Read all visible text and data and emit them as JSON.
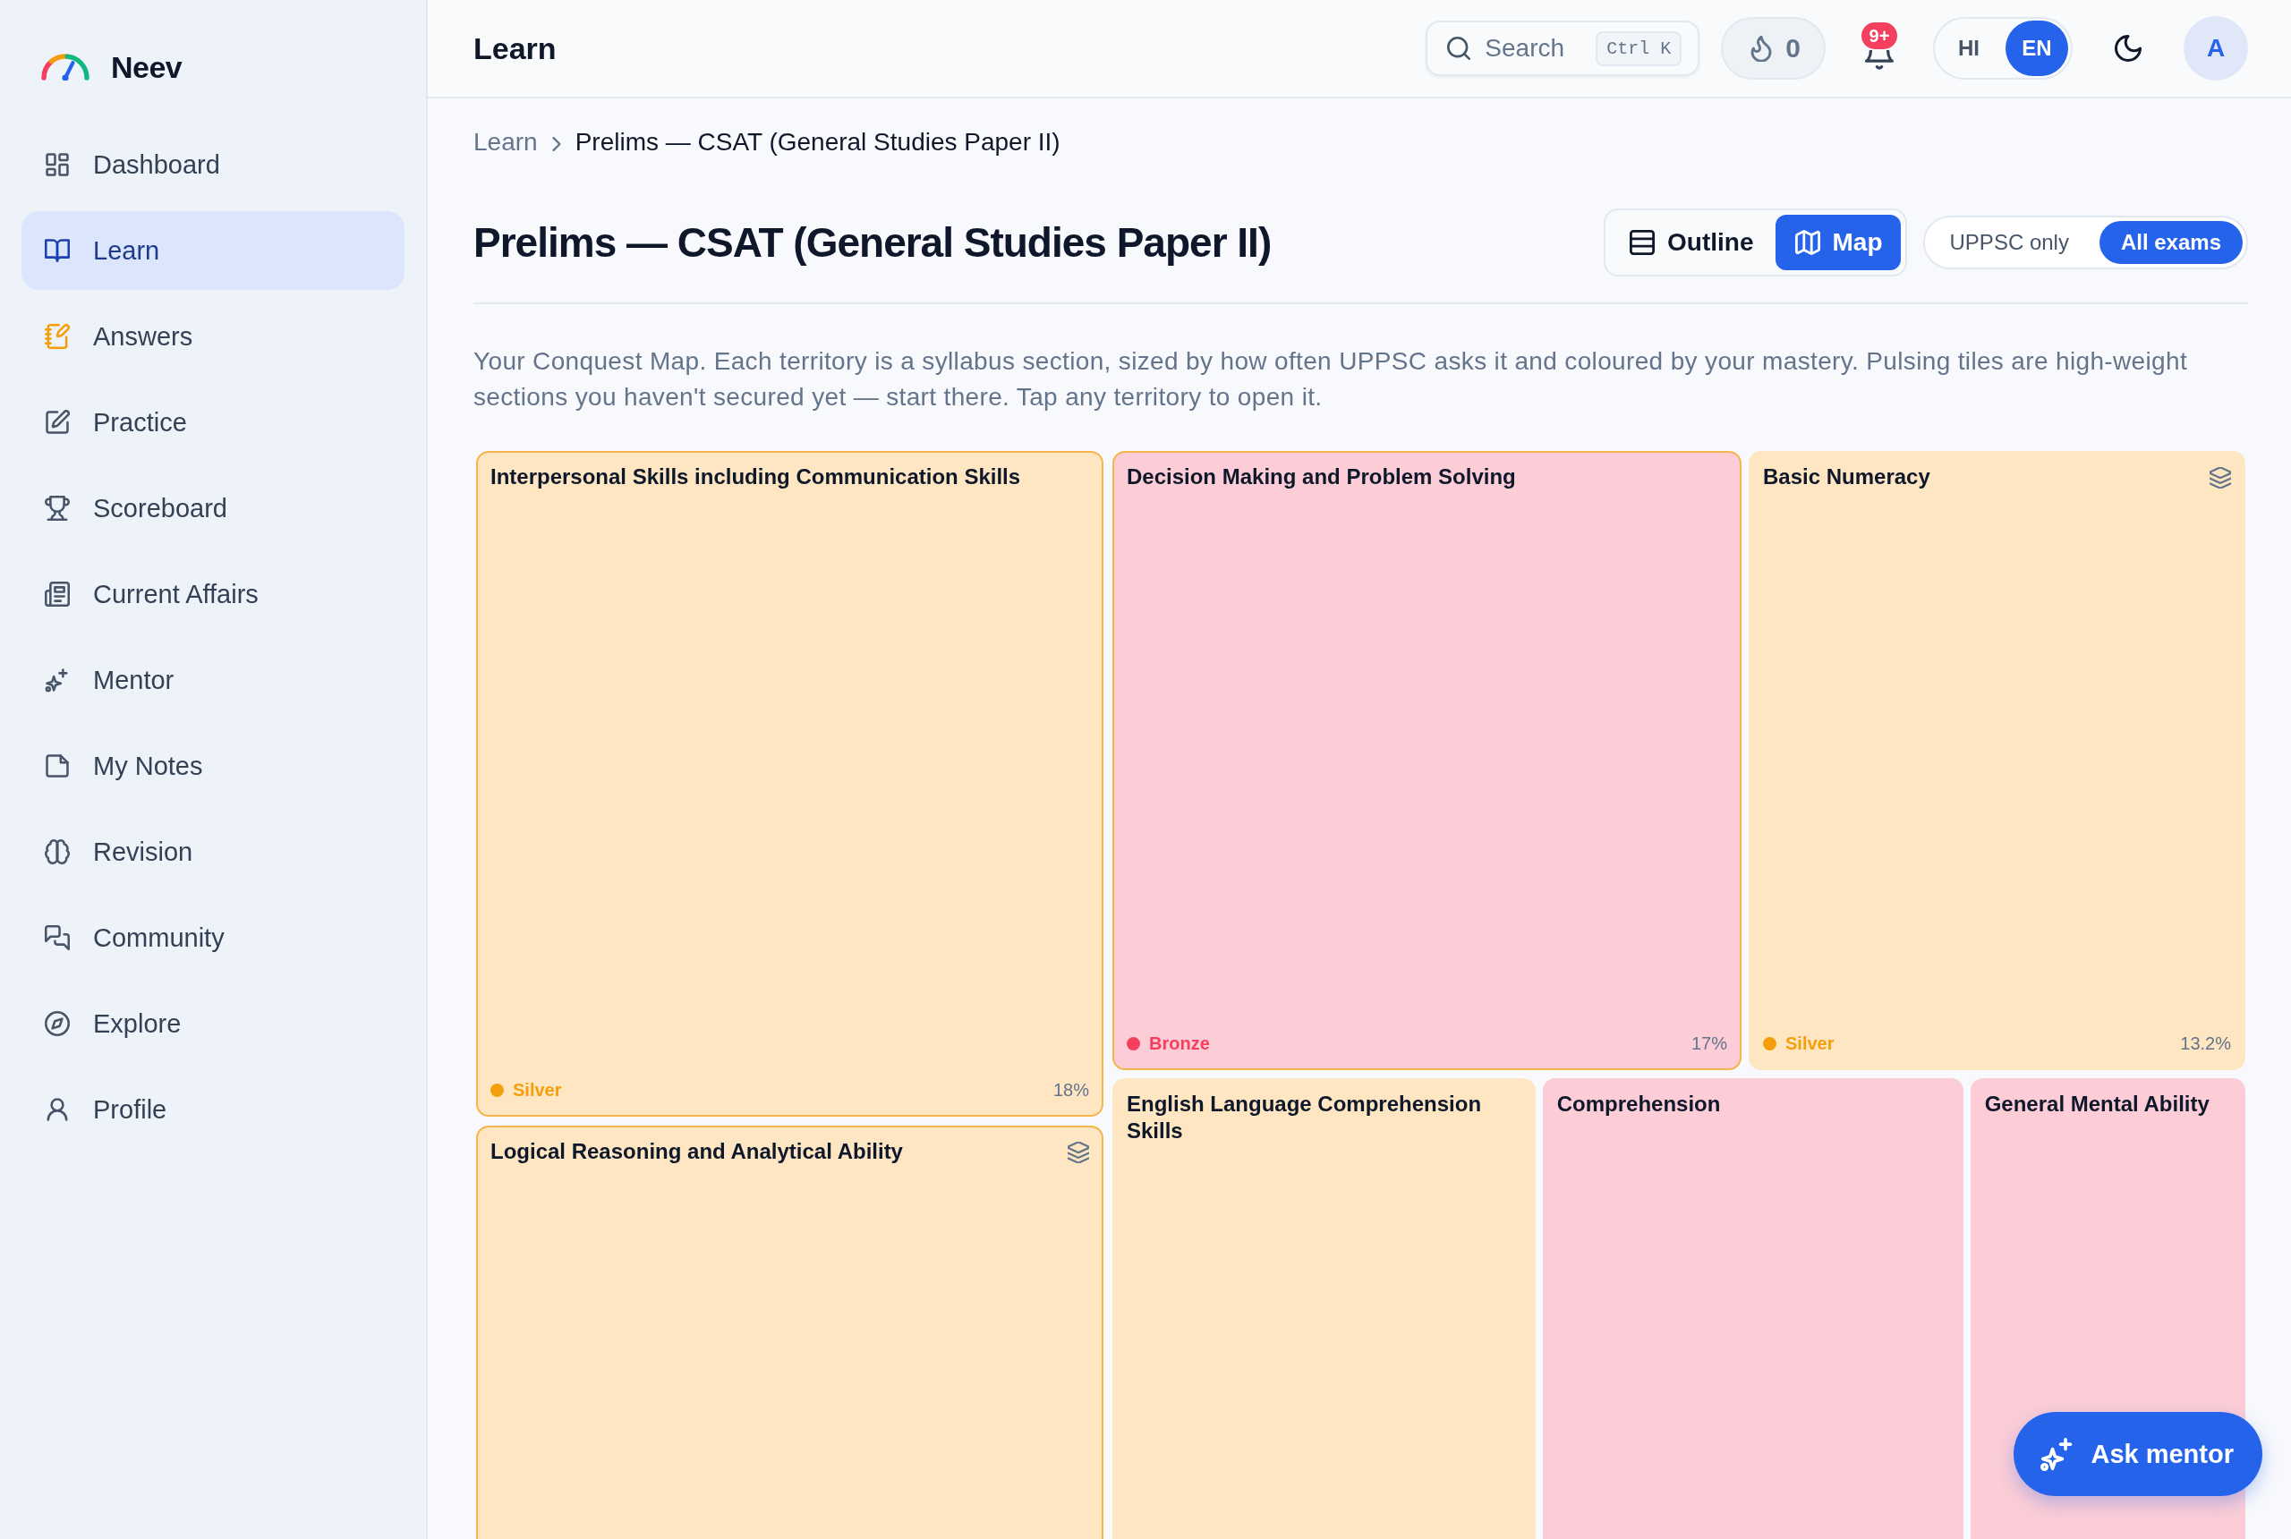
{
  "sidebar": {
    "brand": "Neev",
    "items": [
      {
        "label": "Dashboard",
        "selected": false,
        "accent": false
      },
      {
        "label": "Learn",
        "selected": true,
        "accent": false
      },
      {
        "label": "Answers",
        "selected": false,
        "accent": true
      },
      {
        "label": "Practice",
        "selected": false,
        "accent": false
      },
      {
        "label": "Scoreboard",
        "selected": false,
        "accent": false
      },
      {
        "label": "Current Affairs",
        "selected": false,
        "accent": false
      },
      {
        "label": "Mentor",
        "selected": false,
        "accent": false
      },
      {
        "label": "My Notes",
        "selected": false,
        "accent": false
      },
      {
        "label": "Revision",
        "selected": false,
        "accent": false
      },
      {
        "label": "Community",
        "selected": false,
        "accent": false
      },
      {
        "label": "Explore",
        "selected": false,
        "accent": false
      },
      {
        "label": "Profile",
        "selected": false,
        "accent": false
      }
    ]
  },
  "topbar": {
    "title": "Learn",
    "search": {
      "placeholder": "Search",
      "shortcut": "Ctrl K"
    },
    "streak": "0",
    "notifications": {
      "badge": "9+"
    },
    "languages": [
      {
        "label": "HI",
        "selected": false
      },
      {
        "label": "EN",
        "selected": true
      }
    ],
    "avatar": "A"
  },
  "breadcrumb": [
    "Learn",
    "Prelims — CSAT (General Studies Paper II)"
  ],
  "page": {
    "title": "Prelims — CSAT (General Studies Paper II)",
    "view_modes": [
      {
        "label": "Outline",
        "selected": false
      },
      {
        "label": "Map",
        "selected": true
      }
    ],
    "scopes": [
      {
        "label": "UPPSC only",
        "selected": false
      },
      {
        "label": "All exams",
        "selected": true
      }
    ],
    "description": "Your Conquest Map. Each territory is a syllabus section, sized by how often UPPSC asks it and coloured by your mastery. Pulsing tiles are high-weight sections you haven't secured yet — start there. Tap any territory to open it."
  },
  "treemap": {
    "tiles": [
      {
        "title": "Interpersonal Skills including Communication Skills",
        "kind": "silver",
        "pulsing": true,
        "has_subtopics": false,
        "mastery": "Silver",
        "share": "18%"
      },
      {
        "title": "Logical Reasoning and Analytical Ability",
        "kind": "silver",
        "pulsing": true,
        "has_subtopics": true
      },
      {
        "title": "Decision Making and Problem Solving",
        "kind": "bronze",
        "pulsing": true,
        "has_subtopics": false,
        "mastery": "Bronze",
        "share": "17%"
      },
      {
        "title": "Basic Numeracy",
        "kind": "silver",
        "pulsing": false,
        "has_subtopics": true,
        "mastery": "Silver",
        "share": "13.2%"
      },
      {
        "title": "English Language Comprehension Skills",
        "kind": "silver",
        "pulsing": false,
        "has_subtopics": false
      },
      {
        "title": "Comprehension",
        "kind": "bronze",
        "pulsing": false,
        "has_subtopics": false
      },
      {
        "title": "General Mental Ability",
        "kind": "bronze",
        "pulsing": false,
        "has_subtopics": false
      }
    ]
  },
  "mentor_button": {
    "label": "Ask mentor"
  }
}
